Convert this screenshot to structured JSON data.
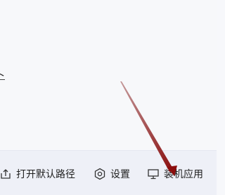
{
  "edge_text": "卜",
  "bottom_bar": {
    "open_default_path": {
      "label": "打开默认路径",
      "icon": "upload-folder-icon"
    },
    "settings": {
      "label": "设置",
      "icon": "gear-icon"
    },
    "install_apps": {
      "label": "装机应用",
      "icon": "monitor-icon"
    }
  },
  "colors": {
    "background": "#f7f8fa",
    "bottom_bar": "#eef0f7",
    "text": "#1e1e1e",
    "annotation_arrow": "#8b0d0d"
  }
}
